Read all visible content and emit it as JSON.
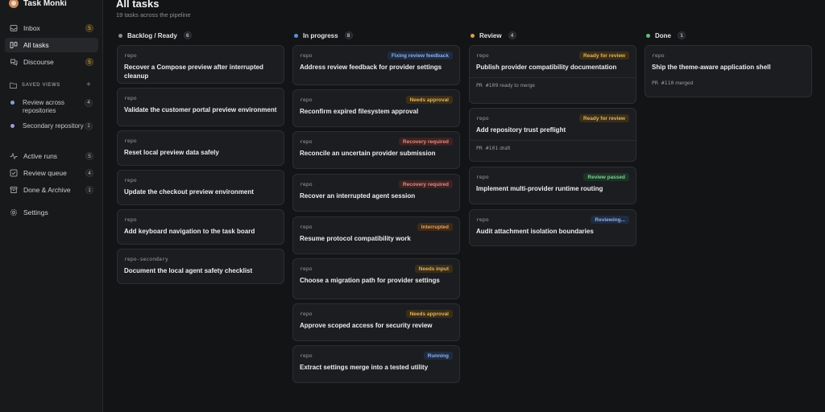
{
  "app": {
    "name": "Task Monki"
  },
  "sidebar": {
    "nav": [
      {
        "label": "Inbox",
        "count": "5",
        "icon": "inbox-icon",
        "warm": true
      },
      {
        "label": "All tasks",
        "count": "",
        "icon": "board-icon",
        "active": true
      },
      {
        "label": "Discourse",
        "count": "5",
        "icon": "chat-icon",
        "warm": true
      }
    ],
    "saved_views_title": "SAVED VIEWS",
    "saved_views": [
      {
        "label": "Review across repositories",
        "count": "4",
        "color": "#7fa3d9"
      },
      {
        "label": "Secondary repository",
        "count": "1",
        "color": "#a995d8"
      }
    ],
    "nav2": [
      {
        "label": "Active runs",
        "count": "5",
        "icon": "activity-icon"
      },
      {
        "label": "Review queue",
        "count": "4",
        "icon": "checklist-icon"
      },
      {
        "label": "Done & Archive",
        "count": "1",
        "icon": "archive-icon"
      },
      {
        "label": "Settings",
        "count": "",
        "icon": "gear-icon"
      }
    ]
  },
  "header": {
    "title": "All tasks",
    "subtitle": "19 tasks across the pipeline"
  },
  "columns": [
    {
      "title": "Backlog / Ready",
      "count": "6",
      "color": "#8a8b90",
      "cards": [
        {
          "repo": "repo",
          "title": "Recover a Compose preview after interrupted cleanup"
        },
        {
          "repo": "repo",
          "title": "Validate the customer portal preview environment"
        },
        {
          "repo": "repo",
          "title": "Reset local preview data safely"
        },
        {
          "repo": "repo",
          "title": "Update the checkout preview environment"
        },
        {
          "repo": "repo",
          "title": "Add keyboard navigation to the task board"
        },
        {
          "repo": "repo-secondary",
          "title": "Document the local agent safety checklist"
        }
      ]
    },
    {
      "title": "In progress",
      "count": "8",
      "color": "#5f8fdc",
      "cards": [
        {
          "repo": "repo",
          "title": "Address review feedback for provider settings",
          "badge": "Fixing review feedback",
          "badge_kind": "blue"
        },
        {
          "repo": "repo",
          "title": "Reconfirm expired filesystem approval",
          "badge": "Needs approval",
          "badge_kind": "amber"
        },
        {
          "repo": "repo",
          "title": "Reconcile an uncertain provider submission",
          "badge": "Recovery required",
          "badge_kind": "red"
        },
        {
          "repo": "repo",
          "title": "Recover an interrupted agent session",
          "badge": "Recovery required",
          "badge_kind": "red"
        },
        {
          "repo": "repo",
          "title": "Resume protocol compatibility work",
          "badge": "Interrupted",
          "badge_kind": "orange"
        },
        {
          "repo": "repo",
          "title": "Choose a migration path for provider settings",
          "badge": "Needs input",
          "badge_kind": "amber"
        },
        {
          "repo": "repo",
          "title": "Approve scoped access for security review",
          "badge": "Needs approval",
          "badge_kind": "amber"
        },
        {
          "repo": "repo",
          "title": "Extract settings merge into a tested utility",
          "badge": "Running",
          "badge_kind": "blue"
        }
      ]
    },
    {
      "title": "Review",
      "count": "4",
      "color": "#d9a04c",
      "cards": [
        {
          "repo": "repo",
          "title": "Publish provider compatibility documentation",
          "badge": "Ready for review",
          "badge_kind": "amber",
          "pr": "PR #109",
          "pr_status": "ready to merge"
        },
        {
          "repo": "repo",
          "title": "Add repository trust preflight",
          "badge": "Ready for review",
          "badge_kind": "amber",
          "pr": "PR #101",
          "pr_status": "draft"
        },
        {
          "repo": "repo",
          "title": "Implement multi-provider runtime routing",
          "badge": "Review passed",
          "badge_kind": "green"
        },
        {
          "repo": "repo",
          "title": "Audit attachment isolation boundaries",
          "badge": "Reviewing...",
          "badge_kind": "blue"
        }
      ]
    },
    {
      "title": "Done",
      "count": "1",
      "color": "#5fbf7a",
      "cards": [
        {
          "repo": "repo",
          "title": "Ship the theme-aware application shell",
          "pr": "PR #110",
          "pr_status": "merged"
        }
      ]
    }
  ],
  "badge_colors": {
    "blue": {
      "bg": "#1f2b40",
      "fg": "#8fb1e8"
    },
    "amber": {
      "bg": "#3a2e18",
      "fg": "#e2b461"
    },
    "red": {
      "bg": "#3d2222",
      "fg": "#e58a7f"
    },
    "orange": {
      "bg": "#3d2a18",
      "fg": "#e6a35c"
    },
    "green": {
      "bg": "#1d3325",
      "fg": "#7fcf97"
    }
  }
}
